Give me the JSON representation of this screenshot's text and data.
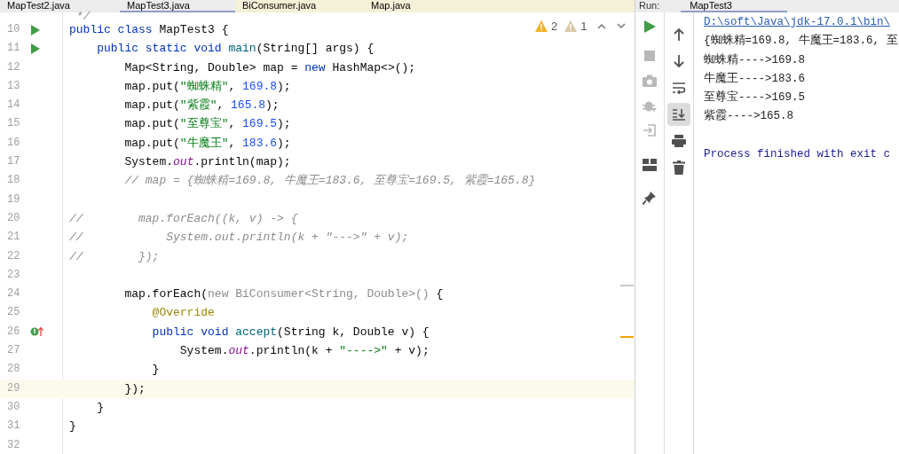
{
  "editor_tabs": [
    {
      "label": "MapTest2.java",
      "selected": false,
      "kind": "class"
    },
    {
      "label": "MapTest3.java",
      "selected": true,
      "kind": "class"
    },
    {
      "label": "BiConsumer.java",
      "selected": false,
      "kind": "library"
    },
    {
      "label": "Map.java",
      "selected": false,
      "kind": "library"
    }
  ],
  "inspections": {
    "warnings": "2",
    "weak_warnings": "1"
  },
  "code_lines": [
    {
      "highlighted": false,
      "segments": [
        {
          "kind": "comment",
          "text": " */"
        }
      ]
    },
    {
      "number": "10",
      "gutter": {
        "kind": "run"
      },
      "highlighted": false,
      "segments": [
        {
          "kind": "kw",
          "text": "public class "
        },
        {
          "kind": "plain",
          "text": "MapTest3 {"
        }
      ]
    },
    {
      "number": "11",
      "gutter": {
        "kind": "run"
      },
      "highlighted": false,
      "segments": [
        {
          "kind": "kw",
          "text": "    public static void "
        },
        {
          "kind": "method",
          "text": "main"
        },
        {
          "kind": "plain",
          "text": "(String[] args) {"
        }
      ]
    },
    {
      "number": "12",
      "highlighted": false,
      "segments": [
        {
          "kind": "plain",
          "text": "        Map<String, Double> map = "
        },
        {
          "kind": "kw",
          "text": "new "
        },
        {
          "kind": "plain",
          "text": "HashMap<>();"
        }
      ]
    },
    {
      "number": "13",
      "highlighted": false,
      "segments": [
        {
          "kind": "plain",
          "text": "        map.put("
        },
        {
          "kind": "str",
          "text": "\"蜘蛛精\""
        },
        {
          "kind": "plain",
          "text": ", "
        },
        {
          "kind": "num",
          "text": "169.8"
        },
        {
          "kind": "plain",
          "text": ");"
        }
      ]
    },
    {
      "number": "14",
      "highlighted": false,
      "segments": [
        {
          "kind": "plain",
          "text": "        map.put("
        },
        {
          "kind": "str",
          "text": "\"紫霞\""
        },
        {
          "kind": "plain",
          "text": ", "
        },
        {
          "kind": "num",
          "text": "165.8"
        },
        {
          "kind": "plain",
          "text": ");"
        }
      ]
    },
    {
      "number": "15",
      "highlighted": false,
      "segments": [
        {
          "kind": "plain",
          "text": "        map.put("
        },
        {
          "kind": "str",
          "text": "\"至尊宝\""
        },
        {
          "kind": "plain",
          "text": ", "
        },
        {
          "kind": "num",
          "text": "169.5"
        },
        {
          "kind": "plain",
          "text": ");"
        }
      ]
    },
    {
      "number": "16",
      "highlighted": false,
      "segments": [
        {
          "kind": "plain",
          "text": "        map.put("
        },
        {
          "kind": "str",
          "text": "\"牛魔王\""
        },
        {
          "kind": "plain",
          "text": ", "
        },
        {
          "kind": "num",
          "text": "183.6"
        },
        {
          "kind": "plain",
          "text": ");"
        }
      ]
    },
    {
      "number": "17",
      "highlighted": false,
      "segments": [
        {
          "kind": "plain",
          "text": "        System."
        },
        {
          "kind": "field",
          "text": "out"
        },
        {
          "kind": "plain",
          "text": ".println(map);"
        }
      ]
    },
    {
      "number": "18",
      "highlighted": false,
      "segments": [
        {
          "kind": "comment",
          "text": "        // map = {蜘蛛精=169.8, 牛魔王=183.6, 至尊宝=169.5, 紫霞=165.8}"
        }
      ]
    },
    {
      "number": "19",
      "highlighted": false
    },
    {
      "number": "20",
      "highlighted": false,
      "segments": [
        {
          "kind": "comment",
          "text": "//        map.forEach((k, v) -> {"
        }
      ]
    },
    {
      "number": "21",
      "highlighted": false,
      "segments": [
        {
          "kind": "comment",
          "text": "//            System.out.println(k + \"--->\" + v);"
        }
      ]
    },
    {
      "number": "22",
      "highlighted": false,
      "segments": [
        {
          "kind": "comment",
          "text": "//        });"
        }
      ]
    },
    {
      "number": "23",
      "highlighted": false
    },
    {
      "number": "24",
      "highlighted": false,
      "segments": [
        {
          "kind": "plain",
          "text": "        map.forEach("
        },
        {
          "kind": "dim",
          "text": "new BiConsumer<String, Double>()"
        },
        {
          "kind": "plain",
          "text": " {"
        }
      ]
    },
    {
      "number": "25",
      "highlighted": false,
      "segments": [
        {
          "kind": "annotation",
          "text": "            @Override"
        }
      ]
    },
    {
      "number": "26",
      "gutter": {
        "kind": "override"
      },
      "highlighted": false,
      "segments": [
        {
          "kind": "kw",
          "text": "            public void "
        },
        {
          "kind": "method",
          "text": "accept"
        },
        {
          "kind": "plain",
          "text": "(String k, Double v) {"
        }
      ]
    },
    {
      "number": "27",
      "highlighted": false,
      "segments": [
        {
          "kind": "plain",
          "text": "                System."
        },
        {
          "kind": "field",
          "text": "out"
        },
        {
          "kind": "plain",
          "text": ".println(k + "
        },
        {
          "kind": "str",
          "text": "\"---->\""
        },
        {
          "kind": "plain",
          "text": " + v);"
        }
      ]
    },
    {
      "number": "28",
      "highlighted": false,
      "segments": [
        {
          "kind": "plain",
          "text": "            }"
        }
      ]
    },
    {
      "number": "29",
      "highlighted": true,
      "segments": [
        {
          "kind": "plain",
          "text": "        });"
        }
      ]
    },
    {
      "number": "30",
      "highlighted": false,
      "segments": [
        {
          "kind": "plain",
          "text": "    }"
        }
      ]
    },
    {
      "number": "31",
      "highlighted": false,
      "segments": [
        {
          "kind": "plain",
          "text": "}"
        }
      ]
    },
    {
      "number": "32",
      "highlighted": false
    }
  ],
  "run_panel": {
    "label": "Run:",
    "tabs": [
      {
        "label": "MapTest3",
        "selected": true
      }
    ],
    "left_toolbar": [
      {
        "kind": "run",
        "disabled": false
      },
      {
        "kind": "stop",
        "disabled": true
      },
      {
        "kind": "camera",
        "disabled": true
      },
      {
        "kind": "debug",
        "disabled": true
      },
      {
        "kind": "login",
        "disabled": true
      },
      {
        "kind": "layout",
        "disabled": false
      },
      {
        "kind": "pin",
        "disabled": false
      }
    ],
    "right_toolbar": [
      {
        "kind": "up",
        "selected": false
      },
      {
        "kind": "down",
        "selected": false
      },
      {
        "kind": "wrap",
        "selected": false
      },
      {
        "kind": "scroll-end",
        "selected": true
      },
      {
        "kind": "print",
        "selected": false
      },
      {
        "kind": "trash",
        "selected": false
      }
    ],
    "console": [
      {
        "kind": "link",
        "text": "D:\\soft\\Java\\jdk-17.0.1\\bin\\"
      },
      {
        "kind": "output",
        "text": "{蜘蛛精=169.8, 牛魔王=183.6, 至"
      },
      {
        "kind": "output",
        "text": "蜘蛛精---->169.8"
      },
      {
        "kind": "output",
        "text": "牛魔王---->183.6"
      },
      {
        "kind": "output",
        "text": "至尊宝---->169.5"
      },
      {
        "kind": "output",
        "text": "紫霞---->165.8"
      },
      {
        "kind": "system",
        "text": "Process finished with exit c"
      }
    ]
  }
}
